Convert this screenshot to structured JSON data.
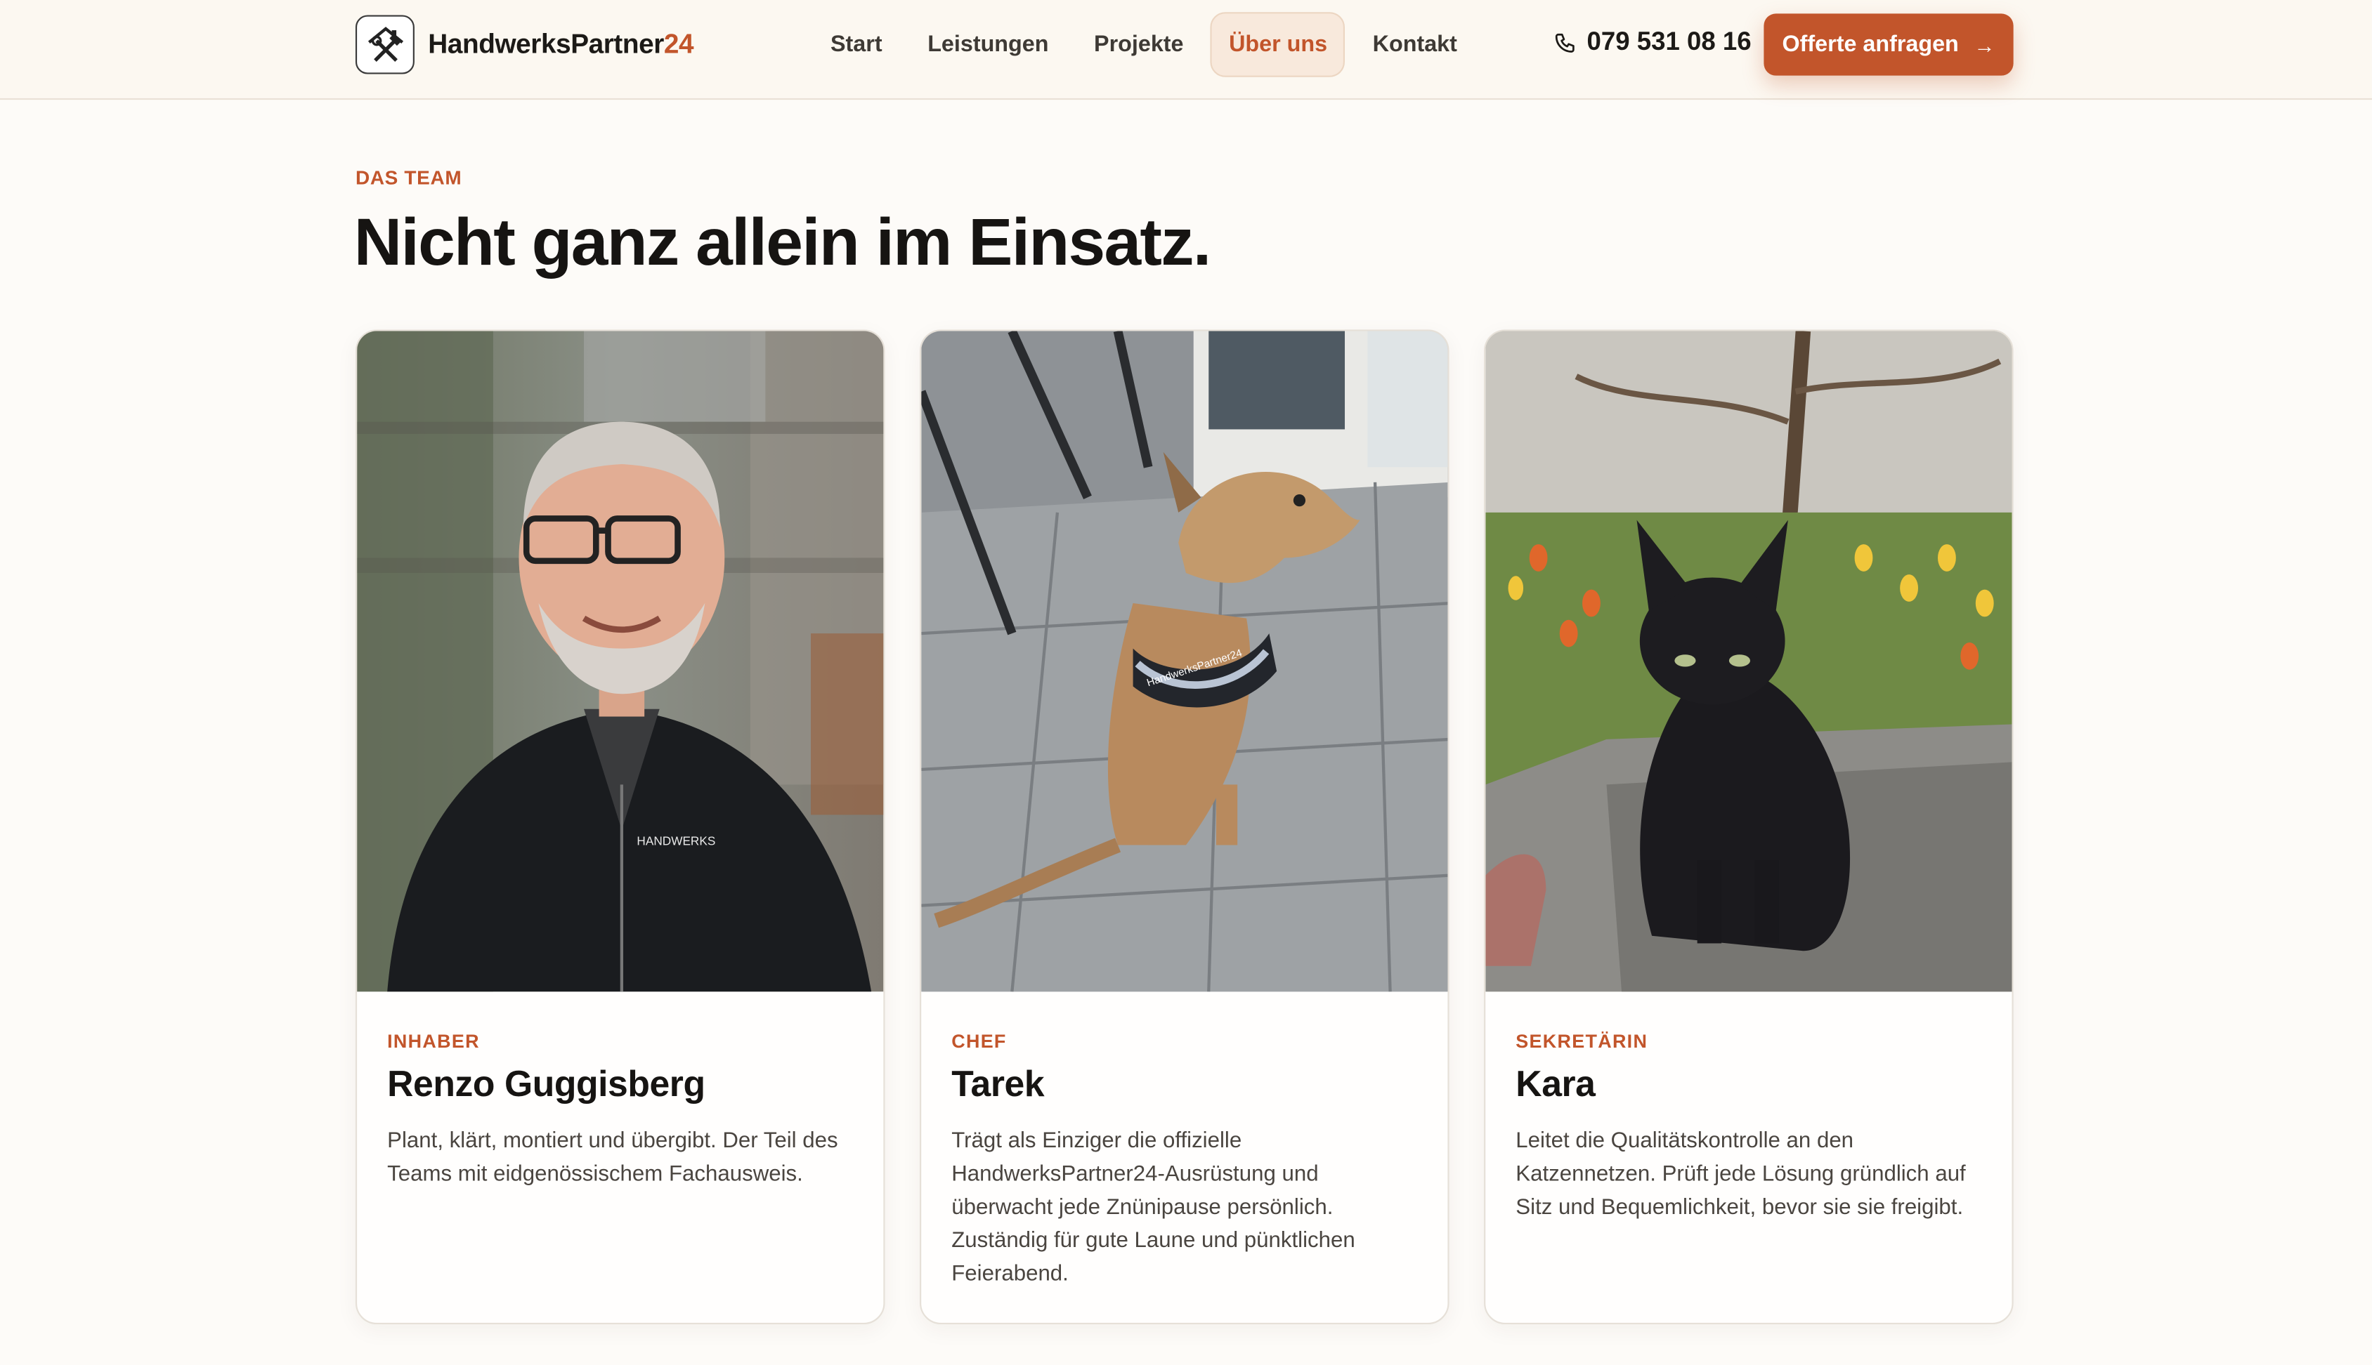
{
  "brand": {
    "name": "HandwerksPartner",
    "name_num": "24"
  },
  "nav": {
    "items": [
      {
        "label": "Start"
      },
      {
        "label": "Leistungen"
      },
      {
        "label": "Projekte"
      },
      {
        "label": "Über uns",
        "active": true
      },
      {
        "label": "Kontakt"
      }
    ]
  },
  "phone": {
    "number": "079 531 08 16"
  },
  "cta": {
    "label": "Offerte anfragen",
    "arrow": "→"
  },
  "section": {
    "eyebrow": "DAS TEAM",
    "title": "Nicht ganz allein im Einsatz."
  },
  "team": [
    {
      "role": "INHABER",
      "name": "Renzo Guggisberg",
      "description": "Plant, klärt, montiert und übergibt. Der Teil des Teams mit eidgenössischem Fachausweis."
    },
    {
      "role": "CHEF",
      "name": "Tarek",
      "description": "Trägt als Einziger die offizielle HandwerksPartner24-Ausrüstung und überwacht jede Znünipause persönlich. Zuständig für gute Laune und pünktlichen Feierabend."
    },
    {
      "role": "SEKRETÄRIN",
      "name": "Kara",
      "description": "Leitet die Qualitätskontrolle an den Katzennetzen. Prüft jede Lösung gründlich auf Sitz und Bequemlichkeit, bevor sie sie freigibt."
    }
  ],
  "colors": {
    "accent": "#c2552b",
    "background": "#fdfbf8",
    "header": "#fcf8f1"
  },
  "icons": [
    "tools-logo-icon",
    "phone-icon",
    "arrow-right-icon"
  ]
}
